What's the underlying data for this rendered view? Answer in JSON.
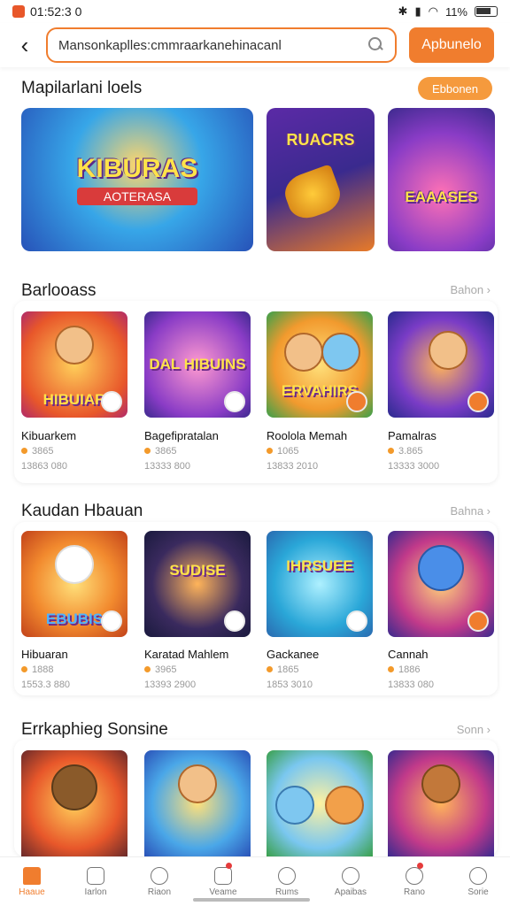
{
  "status_bar": {
    "time": "01:52:3 0",
    "battery": "11%"
  },
  "search": {
    "value": "Mansonkaplles:cmmraarkanehinacanl",
    "button_label": "Apbunelo"
  },
  "featured": {
    "title": "Mapilarlani loels",
    "pill_label": "Ebbonen",
    "banners": [
      {
        "title": "KIBURAS",
        "subtitle": "AOTERASA"
      },
      {
        "title": "RUACRS"
      },
      {
        "title": "EAAASES"
      }
    ]
  },
  "sections": [
    {
      "title": "Barlooass",
      "more": "Bahon ›",
      "games": [
        {
          "name": "Kibuarkem",
          "rating": "3865",
          "downloads": "13863 080",
          "thumb_text": "HIBUIAR"
        },
        {
          "name": "Bagefipratalan",
          "rating": "3865",
          "downloads": "13333 800",
          "thumb_text": "DAL HIBUINS"
        },
        {
          "name": "Roolola Memah",
          "rating": "1065",
          "downloads": "13833 2010",
          "thumb_text": "ERVAHIRS"
        },
        {
          "name": "Pamalras",
          "rating": "3.865",
          "downloads": "13333 3000",
          "thumb_text": ""
        }
      ]
    },
    {
      "title": "Kaudan Hbauan",
      "more": "Bahna ›",
      "games": [
        {
          "name": "Hibuaran",
          "rating": "1888",
          "downloads": "1553.3 880",
          "thumb_text": "EBUBIS"
        },
        {
          "name": "Karatad Mahlem",
          "rating": "3965",
          "downloads": "13393 2900",
          "thumb_text": "SUDISE"
        },
        {
          "name": "Gackanee",
          "rating": "1865",
          "downloads": "1853 3010",
          "thumb_text": "IHRSUEE"
        },
        {
          "name": "Cannah",
          "rating": "1886",
          "downloads": "13833 080",
          "thumb_text": ""
        }
      ]
    },
    {
      "title": "Errkaphieg Sonsine",
      "more": "Sonn ›",
      "games": [
        {
          "thumb_text": ""
        },
        {
          "thumb_text": ""
        },
        {
          "thumb_text": ""
        },
        {
          "thumb_text": ""
        }
      ]
    }
  ],
  "bottom_nav": [
    {
      "label": "Haaue",
      "icon": "home-icon",
      "active": true
    },
    {
      "label": "Iarlon",
      "icon": "house-outline-icon"
    },
    {
      "label": "Riaon",
      "icon": "search-circle-icon"
    },
    {
      "label": "Veame",
      "icon": "inbox-icon",
      "badge": true
    },
    {
      "label": "Rums",
      "icon": "check-circle-icon"
    },
    {
      "label": "Apaibas",
      "icon": "person-icon"
    },
    {
      "label": "Rano",
      "icon": "bell-circle-icon",
      "badge": true
    },
    {
      "label": "Sorie",
      "icon": "profile-icon"
    }
  ],
  "colors": {
    "accent": "#f07d2e",
    "pill": "#f59a3d"
  }
}
